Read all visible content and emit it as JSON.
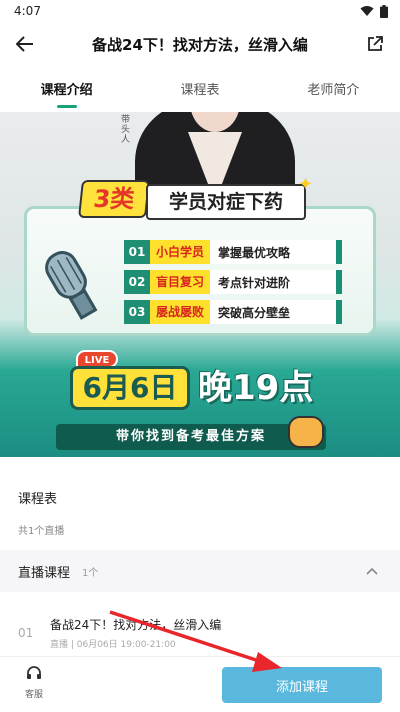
{
  "status_bar": {
    "time": "4:07"
  },
  "header": {
    "title": "备战24下！找对方法，丝滑入编"
  },
  "tabs": [
    {
      "label": "课程介绍",
      "active": true
    },
    {
      "label": "课程表",
      "active": false
    },
    {
      "label": "老师简介",
      "active": false
    }
  ],
  "banner": {
    "tag": "带头人",
    "badge": "3类",
    "headline": "学员对症下药",
    "rows": [
      {
        "num": "01",
        "tag": "小白学员",
        "text": "掌握最优攻略"
      },
      {
        "num": "02",
        "tag": "盲目复习",
        "text": "考点针对进阶"
      },
      {
        "num": "03",
        "tag": "屡战屡败",
        "text": "突破高分壁垒"
      }
    ],
    "live_tag": "LIVE",
    "date": "6月6日",
    "time": "晚19点",
    "slogan": "带你找到备考最佳方案"
  },
  "schedule": {
    "title": "课程表",
    "count": "共1个直播",
    "group": {
      "title": "直播课程",
      "count": "1个"
    },
    "items": [
      {
        "index": "01",
        "title": "备战24下！找对方法，丝滑入编",
        "meta": "直播 | 06月06日 19:00-21:00"
      }
    ]
  },
  "bottom_bar": {
    "service_label": "客服",
    "add_button": "添加课程"
  },
  "colors": {
    "accent": "#1aa37a",
    "button": "#5ab8de",
    "arrow": "#e8262b"
  }
}
